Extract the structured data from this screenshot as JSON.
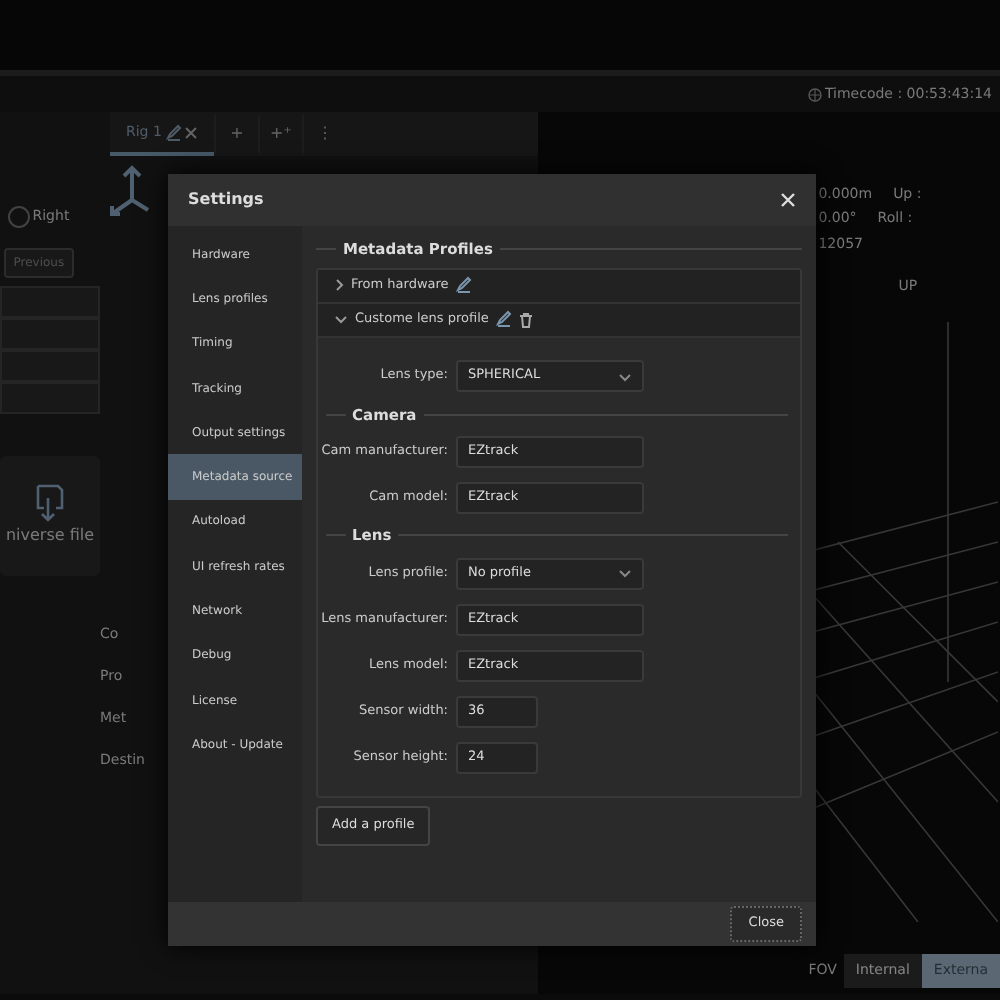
{
  "app": {
    "timecode": "Timecode : 00:53:43:14",
    "tabs": [
      {
        "label": "Rig 1",
        "selected": true
      }
    ],
    "tab_actions": [
      "+",
      "+⁺",
      "⋮"
    ],
    "left_panel": {
      "step_label": "Right",
      "previous_button": "Previous",
      "universe_card": "niverse file",
      "labels": [
        "Co",
        "Pro",
        "Met",
        "Destin"
      ]
    },
    "viewport": {
      "readouts": [
        {
          "value": "0.000m",
          "label": "Up :"
        },
        {
          "value": "0.00°",
          "label": "Roll :"
        },
        {
          "value": "12057"
        }
      ],
      "axis_label": "UP",
      "fov_label": "FOV",
      "modes": [
        {
          "label": "Internal",
          "selected": false
        },
        {
          "label": "Externa",
          "selected": true
        }
      ]
    }
  },
  "settings": {
    "title": "Settings",
    "sidebar": [
      {
        "label": "Hardware",
        "selected": false
      },
      {
        "label": "Lens profiles",
        "selected": false
      },
      {
        "label": "Timing",
        "selected": false
      },
      {
        "label": "Tracking",
        "selected": false
      },
      {
        "label": "Output settings",
        "selected": false
      },
      {
        "label": "Metadata source",
        "selected": true
      },
      {
        "label": "Autoload",
        "selected": false
      },
      {
        "label": "UI refresh rates",
        "selected": false
      },
      {
        "label": "Network",
        "selected": false
      },
      {
        "label": "Debug",
        "selected": false
      },
      {
        "label": "License",
        "selected": false
      },
      {
        "label": "About - Update",
        "selected": false
      }
    ],
    "section_title": "Metadata Profiles",
    "profiles": [
      {
        "name": "From hardware",
        "expanded": false
      },
      {
        "name": "Custome lens profile",
        "expanded": true
      }
    ],
    "lens_type": {
      "label": "Lens type:",
      "value": "SPHERICAL",
      "kind": "select"
    },
    "groups": [
      {
        "title": "Camera",
        "fields": [
          {
            "label": "Cam manufacturer:",
            "value": "EZtrack",
            "kind": "text"
          },
          {
            "label": "Cam model:",
            "value": "EZtrack",
            "kind": "text"
          }
        ]
      },
      {
        "title": "Lens",
        "fields": [
          {
            "label": "Lens profile:",
            "value": "No profile",
            "kind": "select"
          },
          {
            "label": "Lens manufacturer:",
            "value": "EZtrack",
            "kind": "text"
          },
          {
            "label": "Lens model:",
            "value": "EZtrack",
            "kind": "text"
          },
          {
            "label": "Sensor width:",
            "value": "36",
            "kind": "number"
          },
          {
            "label": "Sensor height:",
            "value": "24",
            "kind": "number"
          }
        ]
      }
    ],
    "add_button": "Add a profile",
    "close_button": "Close"
  }
}
